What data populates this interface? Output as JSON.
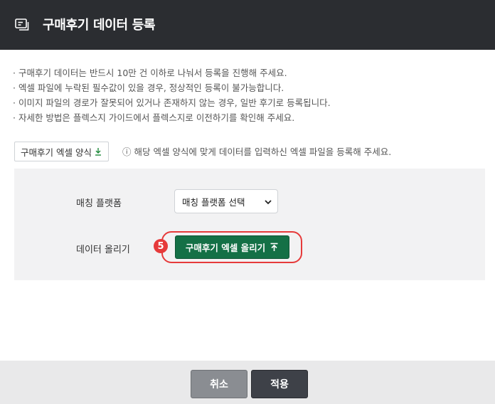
{
  "header": {
    "title": "구매후기 데이터 등록",
    "icon": "review-card-icon"
  },
  "notes": [
    "· 구매후기 데이터는 반드시 10만 건 이하로 나눠서 등록을 진행해 주세요.",
    "· 엑셀 파일에 누락된 필수값이 있을 경우, 정상적인 등록이 불가능합니다.",
    "· 이미지 파일의 경로가 잘못되어 있거나 존재하지 않는 경우, 일반 후기로 등록됩니다.",
    "· 자세한 방법은 플렉스지 가이드에서 플렉스지로 이전하기를 확인해 주세요."
  ],
  "template": {
    "button_label": "구매후기 엑셀 양식",
    "button_icon": "download-icon",
    "hint": "ⓘ 해당 엑셀 양식에 맞게 데이터를 입력하신 엑셀 파일을 등록해 주세요."
  },
  "form": {
    "platform_label": "매칭 플랫폼",
    "platform_select_value": "매칭 플랫폼 선택",
    "upload_label": "데이터 올리기",
    "upload_button": "구매후기 엑셀 올리기",
    "upload_icon": "upload-arrow-icon",
    "step_badge": "5"
  },
  "footer": {
    "cancel": "취소",
    "apply": "적용"
  },
  "colors": {
    "header_bg": "#2b2d31",
    "upload_button": "#147046",
    "highlight": "#e63a3a",
    "cancel_button": "#8a8d92",
    "apply_button": "#3e4148"
  }
}
